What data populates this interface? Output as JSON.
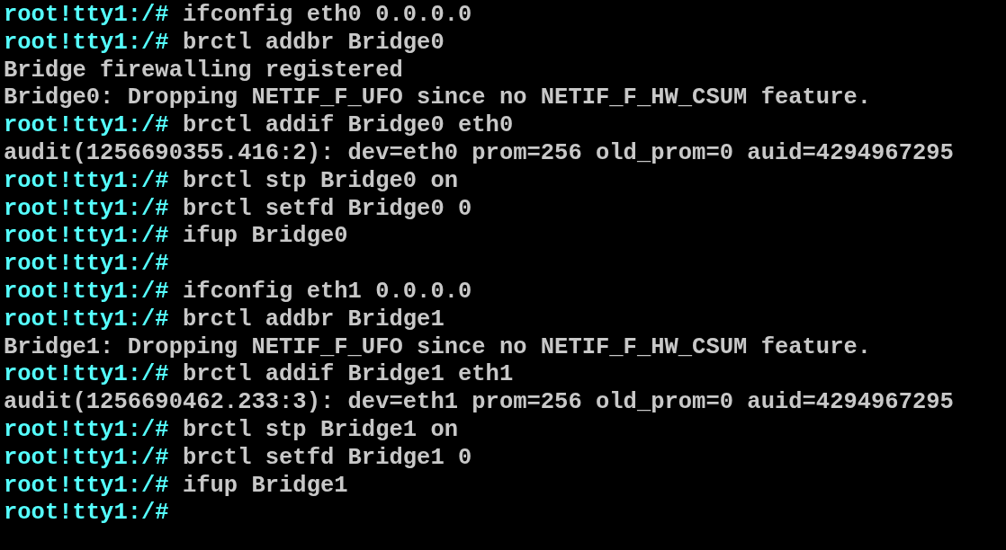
{
  "terminal": {
    "lines": [
      {
        "kind": "prompt",
        "prompt": "root!tty1:/#",
        "command": "ifconfig eth0 0.0.0.0"
      },
      {
        "kind": "prompt",
        "prompt": "root!tty1:/#",
        "command": "brctl addbr Bridge0"
      },
      {
        "kind": "output",
        "text": "Bridge firewalling registered"
      },
      {
        "kind": "output",
        "text": "Bridge0: Dropping NETIF_F_UFO since no NETIF_F_HW_CSUM feature."
      },
      {
        "kind": "prompt",
        "prompt": "root!tty1:/#",
        "command": "brctl addif Bridge0 eth0"
      },
      {
        "kind": "output",
        "text": "audit(1256690355.416:2): dev=eth0 prom=256 old_prom=0 auid=4294967295"
      },
      {
        "kind": "prompt",
        "prompt": "root!tty1:/#",
        "command": "brctl stp Bridge0 on"
      },
      {
        "kind": "prompt",
        "prompt": "root!tty1:/#",
        "command": "brctl setfd Bridge0 0"
      },
      {
        "kind": "prompt",
        "prompt": "root!tty1:/#",
        "command": "ifup Bridge0"
      },
      {
        "kind": "prompt",
        "prompt": "root!tty1:/#"
      },
      {
        "kind": "prompt",
        "prompt": "root!tty1:/#",
        "command": "ifconfig eth1 0.0.0.0"
      },
      {
        "kind": "prompt",
        "prompt": "root!tty1:/#",
        "command": "brctl addbr Bridge1"
      },
      {
        "kind": "output",
        "text": "Bridge1: Dropping NETIF_F_UFO since no NETIF_F_HW_CSUM feature."
      },
      {
        "kind": "prompt",
        "prompt": "root!tty1:/#",
        "command": "brctl addif Bridge1 eth1"
      },
      {
        "kind": "output",
        "text": "audit(1256690462.233:3): dev=eth1 prom=256 old_prom=0 auid=4294967295"
      },
      {
        "kind": "prompt",
        "prompt": "root!tty1:/#",
        "command": "brctl stp Bridge1 on"
      },
      {
        "kind": "prompt",
        "prompt": "root!tty1:/#",
        "command": "brctl setfd Bridge1 0"
      },
      {
        "kind": "prompt",
        "prompt": "root!tty1:/#",
        "command": "ifup Bridge1"
      },
      {
        "kind": "prompt",
        "prompt": "root!tty1:/#"
      }
    ]
  }
}
